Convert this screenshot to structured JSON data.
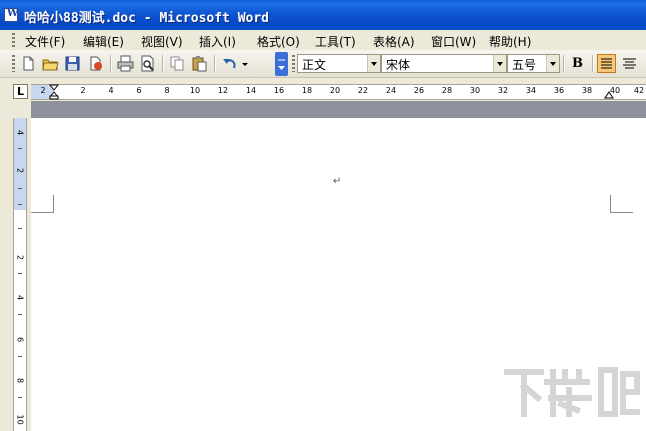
{
  "window": {
    "title": "哈哈小88测试.doc - Microsoft Word",
    "app_icon_letter": "W"
  },
  "menu": {
    "items": [
      "文件(F)",
      "编辑(E)",
      "视图(V)",
      "插入(I)",
      "格式(O)",
      "工具(T)",
      "表格(A)",
      "窗口(W)",
      "帮助(H)"
    ]
  },
  "toolbar": {
    "style_value": "正文",
    "font_value": "宋体",
    "size_value": "五号",
    "bold_label": "B"
  },
  "ruler": {
    "corner_label": "L",
    "numbers": [
      "2",
      "2",
      "4",
      "6",
      "8",
      "10",
      "12",
      "14",
      "16",
      "18",
      "20",
      "22",
      "24",
      "26",
      "28",
      "30",
      "32",
      "34",
      "36",
      "38",
      "40",
      "42"
    ],
    "vertical_numbers": [
      "4",
      "2",
      "2",
      "4",
      "6",
      "8",
      "10"
    ]
  },
  "document": {
    "paragraph_mark": "↵"
  },
  "watermark": {
    "text": "下载吧"
  }
}
